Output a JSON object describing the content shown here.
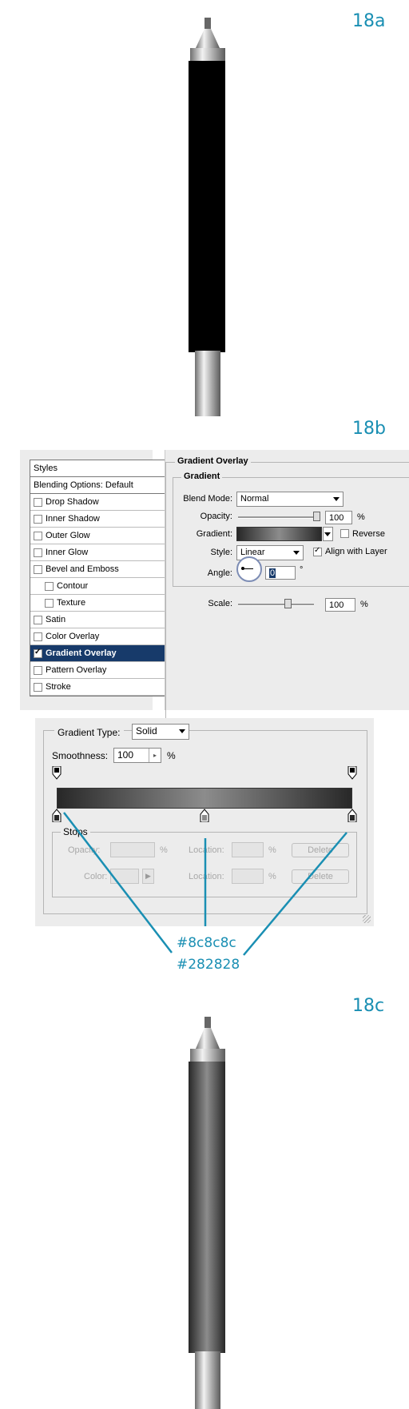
{
  "steps": {
    "a": "18a",
    "b": "18b",
    "c": "18c"
  },
  "styles_panel": {
    "header": "Styles",
    "blending": "Blending Options: Default",
    "items": [
      {
        "label": "Drop Shadow",
        "checked": false,
        "indent": false,
        "selected": false
      },
      {
        "label": "Inner Shadow",
        "checked": false,
        "indent": false,
        "selected": false
      },
      {
        "label": "Outer Glow",
        "checked": false,
        "indent": false,
        "selected": false
      },
      {
        "label": "Inner Glow",
        "checked": false,
        "indent": false,
        "selected": false
      },
      {
        "label": "Bevel and Emboss",
        "checked": false,
        "indent": false,
        "selected": false
      },
      {
        "label": "Contour",
        "checked": false,
        "indent": true,
        "selected": false
      },
      {
        "label": "Texture",
        "checked": false,
        "indent": true,
        "selected": false
      },
      {
        "label": "Satin",
        "checked": false,
        "indent": false,
        "selected": false
      },
      {
        "label": "Color Overlay",
        "checked": false,
        "indent": false,
        "selected": false
      },
      {
        "label": "Gradient Overlay",
        "checked": true,
        "indent": false,
        "selected": true
      },
      {
        "label": "Pattern Overlay",
        "checked": false,
        "indent": false,
        "selected": false
      },
      {
        "label": "Stroke",
        "checked": false,
        "indent": false,
        "selected": false
      }
    ]
  },
  "gradient_overlay": {
    "title": "Gradient Overlay",
    "group": "Gradient",
    "blend_mode_label": "Blend Mode:",
    "blend_mode": "Normal",
    "opacity_label": "Opacity:",
    "opacity": "100",
    "opacity_unit": "%",
    "gradient_label": "Gradient:",
    "reverse_label": "Reverse",
    "reverse_checked": false,
    "style_label": "Style:",
    "style": "Linear",
    "align_label": "Align with Layer",
    "align_checked": true,
    "angle_label": "Angle:",
    "angle": "0",
    "angle_unit": "°",
    "scale_label": "Scale:",
    "scale": "100",
    "scale_unit": "%"
  },
  "gradient_editor": {
    "type_label": "Gradient Type:",
    "type": "Solid",
    "smoothness_label": "Smoothness:",
    "smoothness": "100",
    "smoothness_unit": "%",
    "stops_label": "Stops",
    "opacity_label": "Opacity:",
    "opacity_unit": "%",
    "location_label": "Location:",
    "location_unit": "%",
    "color_label": "Color:",
    "delete_label": "Delete",
    "color_stops": [
      {
        "location": 0,
        "color": "#282828"
      },
      {
        "location": 50,
        "color": "#8c8c8c"
      },
      {
        "location": 100,
        "color": "#282828"
      }
    ]
  },
  "annotations": {
    "color1": "#8c8c8c",
    "color2": "#282828"
  },
  "colors": {
    "accent": "#1a8fb3",
    "selected": "#173a6a"
  }
}
